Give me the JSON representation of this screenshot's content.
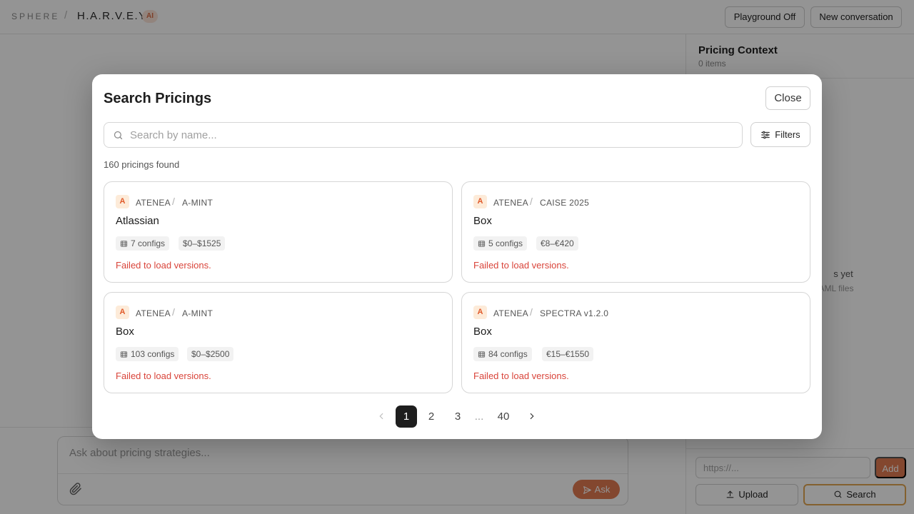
{
  "header": {
    "brand": "SPHERE",
    "separator": "/",
    "project": "H.A.R.V.E.Y.",
    "ai_badge": "AI",
    "playground_button": "Playground Off",
    "new_conversation_button": "New conversation"
  },
  "composer": {
    "placeholder": "Ask about pricing strategies...",
    "ask_button": "Ask"
  },
  "context_panel": {
    "title": "Pricing Context",
    "count": "0 items",
    "empty_title": "s yet",
    "empty_subtitle": "AML files",
    "url_placeholder": "https://...",
    "add_button": "Add",
    "upload_button": "Upload",
    "search_button": "Search"
  },
  "modal": {
    "title": "Search Pricings",
    "close_button": "Close",
    "search_placeholder": "Search by name...",
    "filters_button": "Filters",
    "results_count": "160 pricings found",
    "cards": [
      {
        "avatar": "A",
        "owner": "ATENEA",
        "collection": "A-MINT",
        "name": "Atlassian",
        "configs": "7 configs",
        "price_range": "$0–$1525",
        "error": "Failed to load versions."
      },
      {
        "avatar": "A",
        "owner": "ATENEA",
        "collection": "CAISE 2025",
        "name": "Box",
        "configs": "5 configs",
        "price_range": "€8–€420",
        "error": "Failed to load versions."
      },
      {
        "avatar": "A",
        "owner": "ATENEA",
        "collection": "A-MINT",
        "name": "Box",
        "configs": "103 configs",
        "price_range": "$0–$2500",
        "error": "Failed to load versions."
      },
      {
        "avatar": "A",
        "owner": "ATENEA",
        "collection": "SPECTRA v1.2.0",
        "name": "Box",
        "configs": "84 configs",
        "price_range": "€15–€1550",
        "error": "Failed to load versions."
      }
    ],
    "pagination": {
      "current": "1",
      "pages": [
        "2",
        "3"
      ],
      "ellipsis": "...",
      "last": "40"
    }
  },
  "colors": {
    "accent": "#e27a52",
    "error": "#d9443a",
    "active_page": "#1e1e1e"
  }
}
